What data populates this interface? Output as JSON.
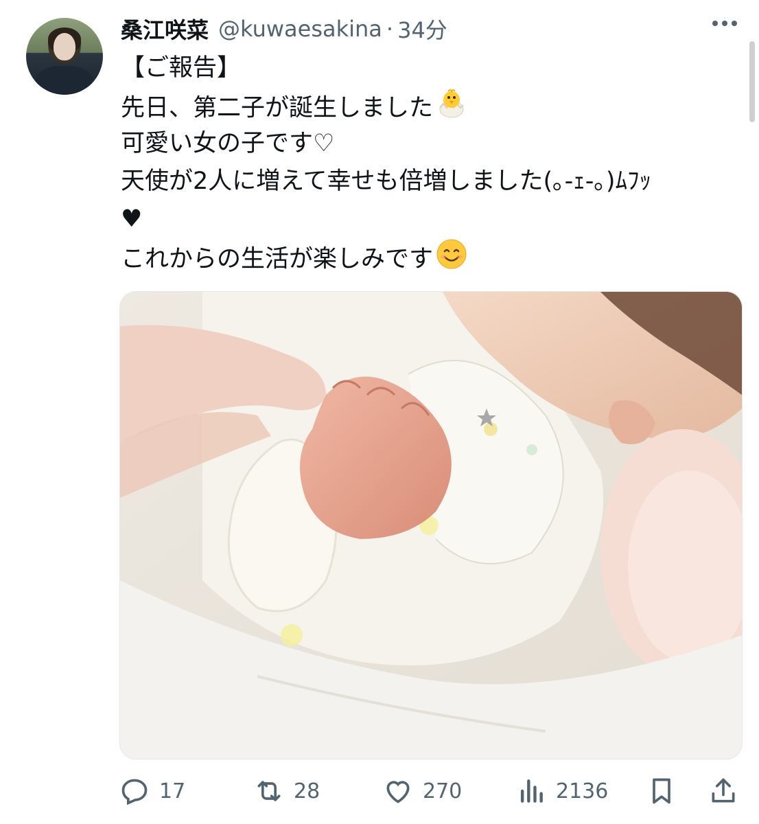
{
  "tweet": {
    "author_name": "桑江咲菜",
    "handle": "@kuwaesakina",
    "separator": "·",
    "time": "34分",
    "lines": [
      "【ご報告】",
      "先日、第二子が誕生しました",
      "可愛い女の子です♡",
      "天使が2人に増えて幸せも倍増しました(｡-ｪ-｡)ﾑﾌｯ",
      "♥",
      "これからの生活が楽しみです"
    ],
    "emojis": {
      "line2": "hatching-chick-icon",
      "line6": "smiling-face-icon"
    }
  },
  "actions": {
    "replies": "17",
    "retweets": "28",
    "likes": "270",
    "views": "2136"
  },
  "colors": {
    "text": "#0f1419",
    "secondary": "#536471"
  }
}
